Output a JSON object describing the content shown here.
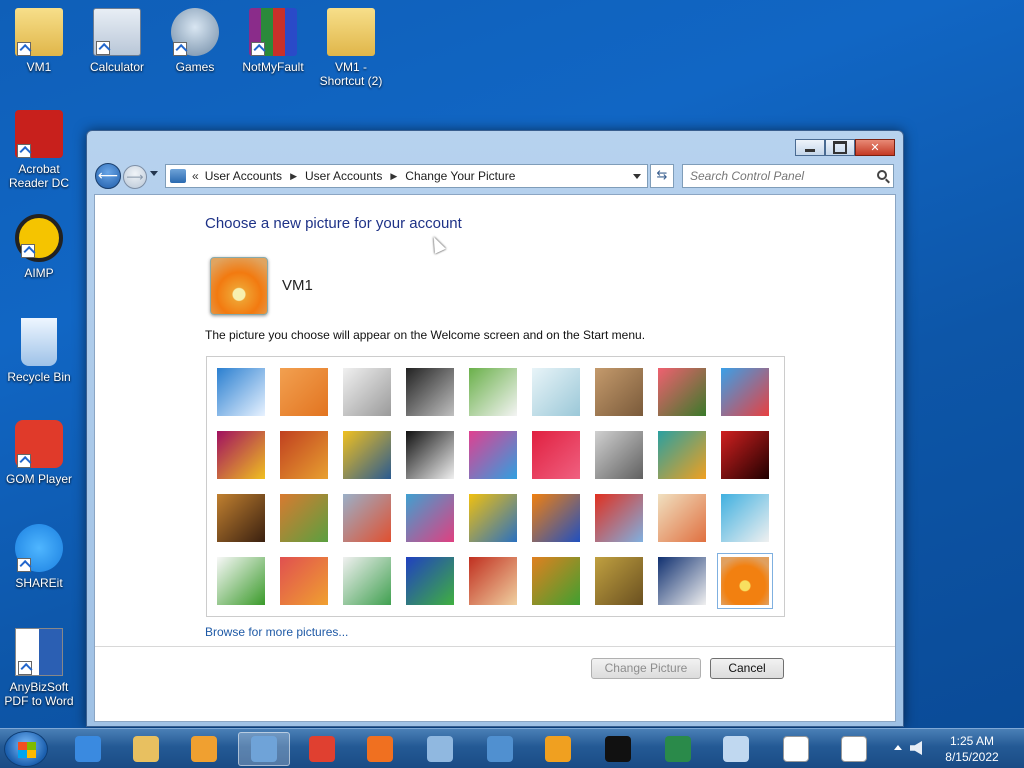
{
  "desktop": {
    "icons": [
      {
        "label": "VM1",
        "icon": "folder-user-icon"
      },
      {
        "label": "Calculator",
        "icon": "calculator-icon"
      },
      {
        "label": "Games",
        "icon": "games-icon"
      },
      {
        "label": "NotMyFault",
        "icon": "winrar-archive-icon"
      },
      {
        "label": "VM1 - Shortcut (2)",
        "icon": "folder-user-icon"
      },
      {
        "label": "Acrobat Reader DC",
        "icon": "acrobat-icon"
      },
      {
        "label": "AIMP",
        "icon": "aimp-icon"
      },
      {
        "label": "Recycle Bin",
        "icon": "recycle-bin-icon"
      },
      {
        "label": "GOM Player",
        "icon": "gom-player-icon"
      },
      {
        "label": "SHAREit",
        "icon": "shareit-icon"
      },
      {
        "label": "AnyBizSoft PDF to Word",
        "icon": "pdf-to-word-icon"
      }
    ]
  },
  "window": {
    "address": {
      "prefix": "«",
      "crumbs": [
        "User Accounts",
        "User Accounts",
        "Change Your Picture"
      ]
    },
    "search_placeholder": "Search Control Panel",
    "heading": "Choose a new picture for your account",
    "account_name": "VM1",
    "description": "The picture you choose will appear on the Welcome screen and on the Start menu.",
    "pictures": [
      {
        "name": "roller-coaster",
        "colors": [
          "#2a7fd0",
          "#e8f2ff"
        ]
      },
      {
        "name": "starfish",
        "colors": [
          "#f2a050",
          "#e27420"
        ]
      },
      {
        "name": "robot-dog",
        "colors": [
          "#f0f0f0",
          "#9a9a9a"
        ]
      },
      {
        "name": "turntable",
        "colors": [
          "#222222",
          "#c0c0c0"
        ]
      },
      {
        "name": "lucky-cat",
        "colors": [
          "#6ab04a",
          "#f4f4f4"
        ]
      },
      {
        "name": "gyroscope",
        "colors": [
          "#e8f4f8",
          "#9bc8d8"
        ]
      },
      {
        "name": "kitten",
        "colors": [
          "#c49a6c",
          "#7a5a3a"
        ]
      },
      {
        "name": "flower-pink",
        "colors": [
          "#f06070",
          "#3a7a2a"
        ]
      },
      {
        "name": "ferris-wheel",
        "colors": [
          "#3aa0e8",
          "#e84040"
        ]
      },
      {
        "name": "ball",
        "colors": [
          "#a01060",
          "#f0c020"
        ]
      },
      {
        "name": "fabric",
        "colors": [
          "#c04020",
          "#e8a030"
        ]
      },
      {
        "name": "leaf",
        "colors": [
          "#f0c020",
          "#2a5a90"
        ]
      },
      {
        "name": "dog",
        "colors": [
          "#111111",
          "#f0f0f0"
        ]
      },
      {
        "name": "crayons",
        "colors": [
          "#e04090",
          "#30a0e0"
        ]
      },
      {
        "name": "paper-star",
        "colors": [
          "#e02040",
          "#f06080"
        ]
      },
      {
        "name": "jacks",
        "colors": [
          "#d0d0d0",
          "#606060"
        ]
      },
      {
        "name": "stairs",
        "colors": [
          "#2aa0a0",
          "#f0a020"
        ]
      },
      {
        "name": "origami-crane",
        "colors": [
          "#d02020",
          "#200000"
        ]
      },
      {
        "name": "guitar",
        "colors": [
          "#c08030",
          "#3a2010"
        ]
      },
      {
        "name": "pomeranian",
        "colors": [
          "#d87a30",
          "#5aa040"
        ]
      },
      {
        "name": "toy-robot",
        "colors": [
          "#9ab0c8",
          "#e05030"
        ]
      },
      {
        "name": "scarf",
        "colors": [
          "#40a0d0",
          "#e04080"
        ]
      },
      {
        "name": "sunflower",
        "colors": [
          "#f0c010",
          "#2a70c0"
        ]
      },
      {
        "name": "fish",
        "colors": [
          "#f08010",
          "#2050c0"
        ]
      },
      {
        "name": "hot-air-balloon",
        "colors": [
          "#e03020",
          "#80b0e0"
        ]
      },
      {
        "name": "doll",
        "colors": [
          "#f0e0c0",
          "#e07040"
        ]
      },
      {
        "name": "sailboat",
        "colors": [
          "#40b0e0",
          "#f0f0f0"
        ]
      },
      {
        "name": "soccer-ball",
        "colors": [
          "#f8f8f8",
          "#3a9a2a"
        ]
      },
      {
        "name": "textile",
        "colors": [
          "#e05050",
          "#f0a030"
        ]
      },
      {
        "name": "marbles",
        "colors": [
          "#f0f0f0",
          "#40a050"
        ]
      },
      {
        "name": "window",
        "colors": [
          "#2040c0",
          "#40b040"
        ]
      },
      {
        "name": "woven-pattern",
        "colors": [
          "#c03020",
          "#f0d0a0"
        ]
      },
      {
        "name": "butterfly",
        "colors": [
          "#e08020",
          "#40a030"
        ]
      },
      {
        "name": "spiral-shell",
        "colors": [
          "#c0a040",
          "#6a5020"
        ]
      },
      {
        "name": "lighthouse",
        "colors": [
          "#103070",
          "#f0f0f0"
        ]
      },
      {
        "name": "orange-daisy",
        "colors": [
          "#f28010",
          "#f8e060"
        ]
      }
    ],
    "selected_index": 35,
    "browse_link": "Browse for more pictures...",
    "change_button": "Change Picture",
    "cancel_button": "Cancel"
  },
  "taskbar": {
    "items": [
      {
        "name": "internet-explorer",
        "color": "#3a8ae0"
      },
      {
        "name": "file-explorer",
        "color": "#e8c060"
      },
      {
        "name": "media-player",
        "color": "#f0a030"
      },
      {
        "name": "control-panel",
        "color": "#6fa3d8",
        "active": true
      },
      {
        "name": "chrome",
        "color": "#e04030"
      },
      {
        "name": "firefox",
        "color": "#f07020"
      },
      {
        "name": "magnifier",
        "color": "#90b8e0"
      },
      {
        "name": "remote-desktop",
        "color": "#5090d0"
      },
      {
        "name": "windows-update",
        "color": "#f0a020"
      },
      {
        "name": "command-prompt",
        "color": "#111111"
      },
      {
        "name": "task-manager",
        "color": "#2a8a4a"
      },
      {
        "name": "notepad-file",
        "color": "#c0d8f0"
      },
      {
        "name": "blank-document",
        "color": "#ffffff"
      },
      {
        "name": "blank-document-2",
        "color": "#ffffff"
      }
    ],
    "time": "1:25 AM",
    "date": "8/15/2022"
  }
}
